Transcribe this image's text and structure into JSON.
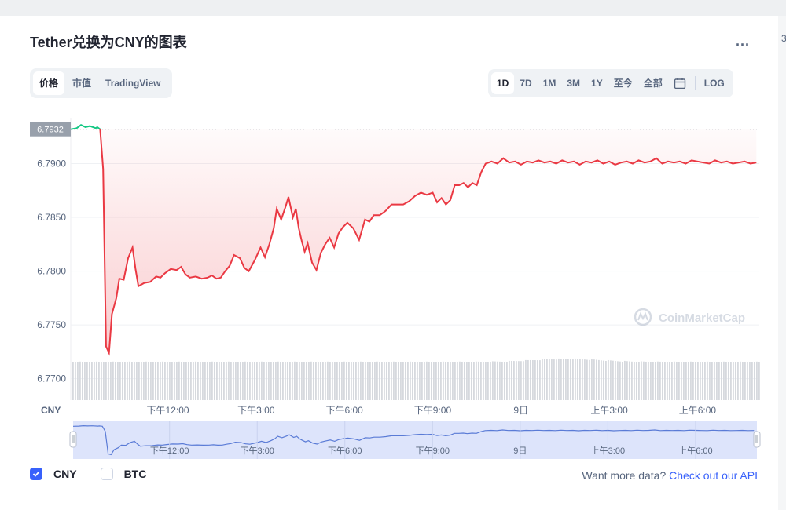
{
  "header": {
    "title": "Tether兑换为CNY的图表",
    "more_label": "...",
    "edge_char": "3"
  },
  "view_tabs": [
    {
      "label": "价格",
      "active": true
    },
    {
      "label": "市值",
      "active": false
    },
    {
      "label": "TradingView",
      "active": false
    }
  ],
  "range_tabs": [
    {
      "label": "1D",
      "active": true
    },
    {
      "label": "7D",
      "active": false
    },
    {
      "label": "1M",
      "active": false
    },
    {
      "label": "3M",
      "active": false
    },
    {
      "label": "1Y",
      "active": false
    },
    {
      "label": "至今",
      "active": false
    },
    {
      "label": "全部",
      "active": false
    }
  ],
  "log_label": "LOG",
  "calendar_icon": "calendar-icon",
  "chart_data": {
    "type": "line",
    "currency_label": "CNY",
    "watermark": "CoinMarketCap",
    "open_value": 6.7932,
    "open_label": "6.7932",
    "ylim": [
      6.768,
      6.7942
    ],
    "yticks": [
      6.77,
      6.775,
      6.78,
      6.785,
      6.79
    ],
    "ytick_labels": [
      "6.7700",
      "6.7750",
      "6.7800",
      "6.7850",
      "6.7900"
    ],
    "xlim": [
      8.7,
      32.1
    ],
    "xticks": [
      12,
      15,
      18,
      21,
      24,
      27,
      30
    ],
    "xtick_labels": [
      "下午12:00",
      "下午3:00",
      "下午6:00",
      "下午9:00",
      "9日",
      "上午3:00",
      "上午6:00"
    ],
    "colors": {
      "up": "#16c784",
      "down": "#ea3943",
      "nav_line": "#5a7bd6",
      "nav_fill": "#dde4fb",
      "volume": "#d6d9de"
    },
    "x": [
      8.7,
      8.9,
      9.05,
      9.2,
      9.35,
      9.55,
      9.6,
      9.7,
      9.8,
      9.9,
      10.0,
      10.1,
      10.25,
      10.35,
      10.5,
      10.65,
      10.8,
      10.9,
      11.0,
      11.2,
      11.4,
      11.6,
      11.75,
      11.9,
      12.1,
      12.3,
      12.45,
      12.6,
      12.75,
      12.95,
      13.15,
      13.35,
      13.5,
      13.65,
      13.8,
      13.95,
      14.1,
      14.25,
      14.45,
      14.6,
      14.75,
      14.95,
      15.15,
      15.3,
      15.45,
      15.6,
      15.7,
      15.85,
      16.0,
      16.1,
      16.25,
      16.35,
      16.45,
      16.55,
      16.65,
      16.75,
      16.9,
      17.05,
      17.2,
      17.35,
      17.5,
      17.65,
      17.8,
      17.95,
      18.1,
      18.3,
      18.5,
      18.7,
      18.85,
      19.0,
      19.2,
      19.4,
      19.6,
      19.8,
      20.0,
      20.2,
      20.4,
      20.6,
      20.8,
      21.0,
      21.15,
      21.3,
      21.45,
      21.6,
      21.75,
      21.9,
      22.05,
      22.2,
      22.35,
      22.5,
      22.65,
      22.8,
      23.0,
      23.2,
      23.4,
      23.6,
      23.8,
      24.0,
      24.2,
      24.4,
      24.6,
      24.8,
      25.0,
      25.2,
      25.4,
      25.6,
      25.8,
      26.0,
      26.2,
      26.4,
      26.6,
      26.8,
      27.0,
      27.2,
      27.4,
      27.6,
      27.8,
      28.0,
      28.2,
      28.4,
      28.6,
      28.8,
      29.0,
      29.2,
      29.4,
      29.6,
      29.8,
      30.0,
      30.2,
      30.4,
      30.6,
      30.8,
      31.0,
      31.2,
      31.4,
      31.6,
      31.8,
      32.0
    ],
    "y": [
      6.7932,
      6.7933,
      6.7936,
      6.7934,
      6.7935,
      6.7933,
      6.7934,
      6.7932,
      6.7895,
      6.773,
      6.7724,
      6.776,
      6.7775,
      6.7793,
      6.7792,
      6.7812,
      6.7822,
      6.7802,
      6.7786,
      6.7789,
      6.779,
      6.7795,
      6.7794,
      6.7798,
      6.7802,
      6.7801,
      6.7804,
      6.7797,
      6.7794,
      6.7795,
      6.7793,
      6.7794,
      6.7796,
      6.7793,
      6.7794,
      6.78,
      6.7805,
      6.7815,
      6.7812,
      6.7803,
      6.78,
      6.781,
      6.7822,
      6.7813,
      6.7825,
      6.784,
      6.7858,
      6.7848,
      6.786,
      6.7869,
      6.785,
      6.7858,
      6.784,
      6.7828,
      6.7818,
      6.7826,
      6.7808,
      6.7801,
      6.7817,
      6.7825,
      6.7831,
      6.7822,
      6.7835,
      6.7841,
      6.7845,
      6.784,
      6.7829,
      6.7848,
      6.7846,
      6.7852,
      6.7852,
      6.7856,
      6.7862,
      6.7862,
      6.7862,
      6.7865,
      6.787,
      6.7873,
      6.7871,
      6.7873,
      6.7864,
      6.7868,
      6.7862,
      6.7866,
      6.788,
      6.788,
      6.7882,
      6.7878,
      6.7882,
      6.788,
      6.7892,
      6.79,
      6.7902,
      6.79,
      6.7905,
      6.7901,
      6.7902,
      6.7899,
      6.7902,
      6.7901,
      6.7903,
      6.7901,
      6.7902,
      6.79,
      6.7903,
      6.7901,
      6.7902,
      6.7899,
      6.7902,
      6.7901,
      6.7903,
      6.79,
      6.7902,
      6.7899,
      6.7901,
      6.7902,
      6.79,
      6.7903,
      6.7901,
      6.7902,
      6.7905,
      6.79,
      6.7902,
      6.7901,
      6.7902,
      6.79,
      6.7903,
      6.7902,
      6.7901,
      6.79,
      6.7903,
      6.7901,
      6.7902,
      6.79,
      6.7901,
      6.7902,
      6.79,
      6.7901,
      6.7902,
      6.7901
    ]
  },
  "legend": {
    "items": [
      {
        "label": "CNY",
        "checked": true
      },
      {
        "label": "BTC",
        "checked": false
      }
    ]
  },
  "footer": {
    "prompt": "Want more data?",
    "link": "Check out our API"
  }
}
